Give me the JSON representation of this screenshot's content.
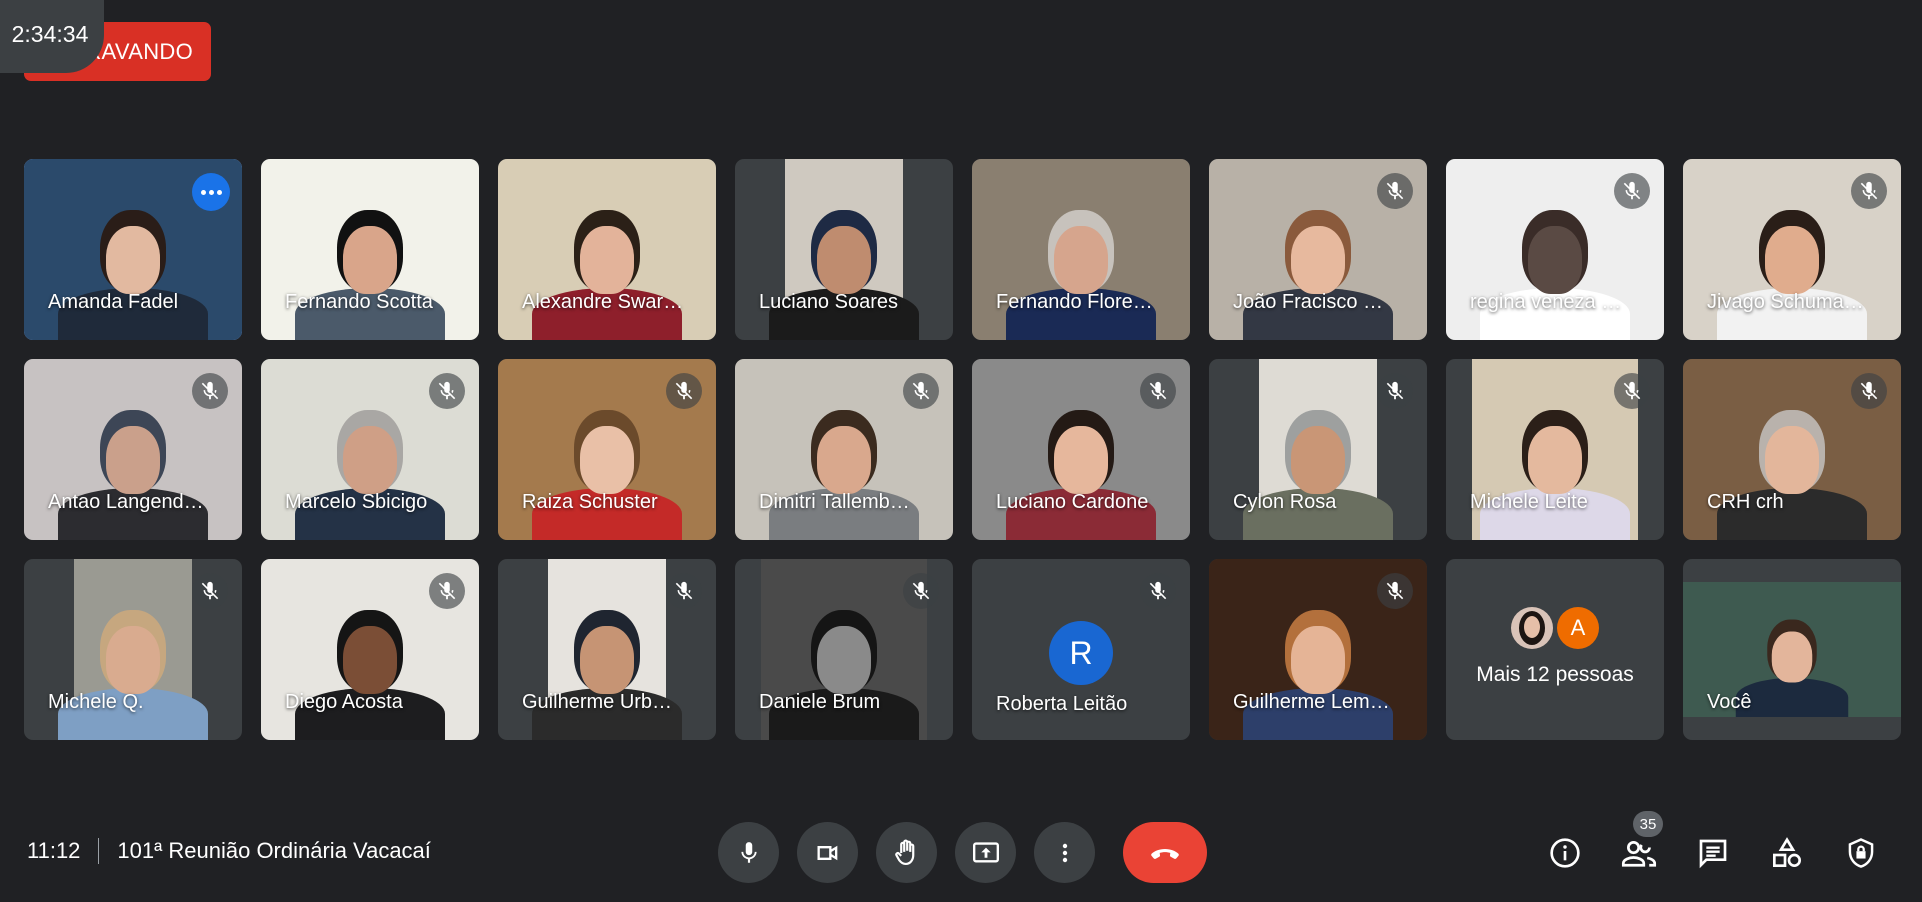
{
  "recording": {
    "label": "GRAVANDO",
    "timer": "2:34:34"
  },
  "participants": [
    {
      "name": "Amanda Fadel",
      "active": true,
      "muted": false,
      "bg": "#2b4a6b",
      "skin": "#e2b9a0",
      "shirt": "#1f2a3a",
      "hair": "#2a1d18"
    },
    {
      "name": "Fernando Scotta",
      "muted": false,
      "bg": "#f2f2ea",
      "skin": "#d9a58a",
      "shirt": "#4b5a6a",
      "hair": "#111111"
    },
    {
      "name": "Alexandre Swar…",
      "muted": false,
      "bg": "#d8cdb5",
      "skin": "#e3b39a",
      "shirt": "#8e1f2b",
      "hair": "#2b2017"
    },
    {
      "name": "Luciano Soares",
      "muted": false,
      "bg": "#cfc9c0",
      "skin": "#bf8c6f",
      "shirt": "#1b1b1b",
      "hair": "#1e2a44",
      "video": "narrow"
    },
    {
      "name": "Fernando Flore…",
      "muted": false,
      "bg": "#8a7f70",
      "skin": "#d6a58d",
      "shirt": "#1a2a55",
      "hair": "#c7c2bc"
    },
    {
      "name": "João Fracisco …",
      "muted": true,
      "bg": "#b8b1a7",
      "skin": "#e7b99e",
      "shirt": "#333844",
      "hair": "#8a5a3c"
    },
    {
      "name": "regina veneza …",
      "muted": true,
      "bg": "#eeeeee",
      "skin": "#5a4a44",
      "shirt": "#ffffff",
      "hair": "#3a2c28"
    },
    {
      "name": "Jivago Schuma…",
      "muted": true,
      "bg": "#d8d2c8",
      "skin": "#e0ac8d",
      "shirt": "#f2f2f2",
      "hair": "#2a1e18"
    },
    {
      "name": "Antao Langend…",
      "muted": true,
      "bg": "#c7c2c2",
      "skin": "#caa08b",
      "shirt": "#2c2c30",
      "hair": "#3d4656"
    },
    {
      "name": "Marcelo Sbicigo",
      "muted": true,
      "bg": "#dcdcd4",
      "skin": "#cf9f86",
      "shirt": "#243246",
      "hair": "#a9a7a4"
    },
    {
      "name": "Raiza Schuster",
      "muted": true,
      "bg": "#a47a4d",
      "skin": "#e9c0a7",
      "shirt": "#c42a28",
      "hair": "#6b4a2b"
    },
    {
      "name": "Dimitri Tallemb…",
      "muted": true,
      "bg": "#c6c2ba",
      "skin": "#d9a88d",
      "shirt": "#7a7d80",
      "hair": "#3b2b1f"
    },
    {
      "name": "Luciano Cardone",
      "muted": true,
      "bg": "#8a8a8a",
      "skin": "#e6b79c",
      "shirt": "#8b2b36",
      "hair": "#241a15"
    },
    {
      "name": "Cylon Rosa",
      "muted": true,
      "bg": "#dedbd4",
      "skin": "#c99676",
      "shirt": "#6a6f60",
      "hair": "#9ea09f",
      "video": "narrow"
    },
    {
      "name": "Michele Leite",
      "muted": true,
      "bg": "#d5c9b3",
      "skin": "#e4b99e",
      "shirt": "#ddd8e8",
      "hair": "#2b1f18",
      "video": "inset"
    },
    {
      "name": "CRH crh",
      "muted": true,
      "bg": "#7a5e44",
      "skin": "#e3b69b",
      "shirt": "#2b2b2b",
      "hair": "#b9b2ac"
    },
    {
      "name": "Michele Q.",
      "muted": true,
      "bg": "#9a9a92",
      "skin": "#d9ab8f",
      "shirt": "#7e9fc4",
      "hair": "#c6a77f",
      "video": "narrow"
    },
    {
      "name": "Diego Acosta",
      "muted": true,
      "bg": "#e7e5e0",
      "skin": "#7b4e36",
      "shirt": "#1d1d1f",
      "hair": "#151515"
    },
    {
      "name": "Guilherme Urb…",
      "muted": true,
      "bg": "#e6e3de",
      "skin": "#c69474",
      "shirt": "#2b2b2b",
      "hair": "#1f2530",
      "video": "narrow"
    },
    {
      "name": "Daniele Brum",
      "muted": true,
      "bg": "#4a4a4a",
      "skin": "#8a8a8a",
      "shirt": "#1a1a1a",
      "hair": "#151515",
      "video": "inset"
    },
    {
      "name": "Roberta Leitão",
      "muted": true,
      "avatar": "R"
    },
    {
      "name": "Guilherme Lem…",
      "muted": true,
      "bg": "#3a2418",
      "skin": "#e5b496",
      "shirt": "#2d3f6a",
      "hair": "#b3703c"
    },
    {
      "name": "Mais 12 pessoas",
      "others": true,
      "avatar_letter": "A"
    },
    {
      "name": "Você",
      "muted": false,
      "self": true,
      "bg": "#3e5a50",
      "skin": "#e3b59b",
      "shirt": "#1c2a3e",
      "hair": "#3a281e"
    }
  ],
  "footer": {
    "time": "11:12",
    "meeting_title": "101ª Reunião Ordinária Vacacaí",
    "participant_count": "35"
  },
  "colors": {
    "accent": "#8ab4f8",
    "end_call": "#ea4335",
    "recording": "#d93025"
  }
}
